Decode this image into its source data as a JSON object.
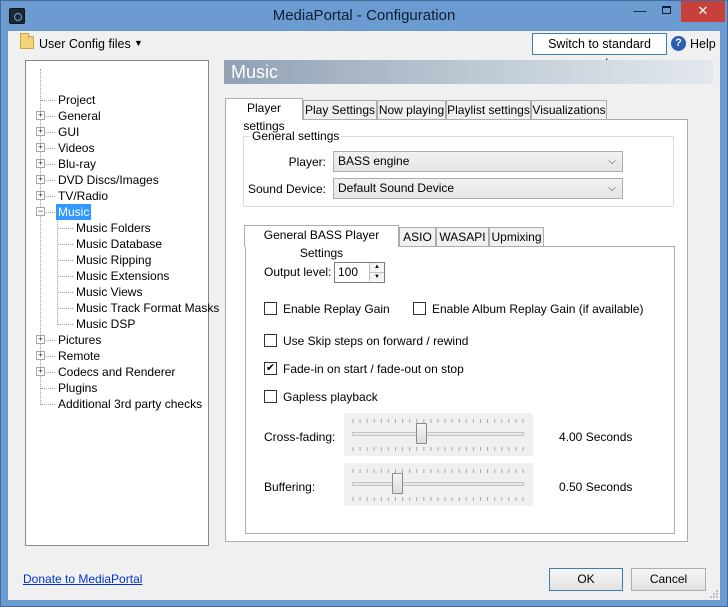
{
  "window": {
    "title": "MediaPortal - Configuration",
    "minimize_glyph": "—",
    "close_glyph": "✕"
  },
  "toolbar": {
    "user_config_label": "User Config files",
    "dropdown_glyph": "▼",
    "standard_mode_label": "Switch to standard mode",
    "help_icon_glyph": "?",
    "help_label": "Help"
  },
  "tree": {
    "expand_glyph": "+",
    "collapse_glyph": "−",
    "items": [
      {
        "label": "Project"
      },
      {
        "label": "General"
      },
      {
        "label": "GUI"
      },
      {
        "label": "Videos"
      },
      {
        "label": "Blu-ray"
      },
      {
        "label": "DVD Discs/Images"
      },
      {
        "label": "TV/Radio"
      },
      {
        "label": "Music"
      },
      {
        "label": "Music Folders"
      },
      {
        "label": "Music Database"
      },
      {
        "label": "Music Ripping"
      },
      {
        "label": "Music Extensions"
      },
      {
        "label": "Music Views"
      },
      {
        "label": "Music Track Format Masks"
      },
      {
        "label": "Music DSP"
      },
      {
        "label": "Pictures"
      },
      {
        "label": "Remote"
      },
      {
        "label": "Codecs and Renderer"
      },
      {
        "label": "Plugins"
      },
      {
        "label": "Additional 3rd party checks"
      }
    ]
  },
  "section": {
    "title": "Music"
  },
  "tabs": [
    {
      "label": "Player settings"
    },
    {
      "label": "Play Settings"
    },
    {
      "label": "Now playing"
    },
    {
      "label": "Playlist settings"
    },
    {
      "label": "Visualizations"
    }
  ],
  "general_settings": {
    "group_title": "General settings",
    "player_label": "Player:",
    "player_value": "BASS engine",
    "device_label": "Sound Device:",
    "device_value": "Default Sound Device",
    "combo_arrow_glyph": "⌵"
  },
  "subtabs": [
    {
      "label": "General BASS Player Settings"
    },
    {
      "label": "ASIO"
    },
    {
      "label": "WASAPI"
    },
    {
      "label": "Upmixing"
    }
  ],
  "bass_settings": {
    "output_level_label": "Output level:",
    "output_level_value": "100",
    "spin_up_glyph": "▲",
    "spin_down_glyph": "▼",
    "check_glyph": "✔",
    "checkboxes": [
      {
        "label": "Enable Replay Gain",
        "checked": false
      },
      {
        "label": "Enable Album Replay Gain (if available)",
        "checked": false
      },
      {
        "label": "Use Skip steps on forward / rewind",
        "checked": false
      },
      {
        "label": "Fade-in on start / fade-out on stop",
        "checked": true
      },
      {
        "label": "Gapless playback",
        "checked": false
      }
    ],
    "crossfade_label": "Cross-fading:",
    "crossfade_value": "4.00 Seconds",
    "crossfade_position": 0.4,
    "buffering_label": "Buffering:",
    "buffering_value": "0.50 Seconds",
    "buffering_position": 0.25
  },
  "footer": {
    "donate_link": "Donate to MediaPortal",
    "ok_label": "OK",
    "cancel_label": "Cancel"
  },
  "colors": {
    "titlebar": "#6b9bd0",
    "close_button": "#c7403a",
    "selection": "#3399ff",
    "link": "#0033cc"
  }
}
